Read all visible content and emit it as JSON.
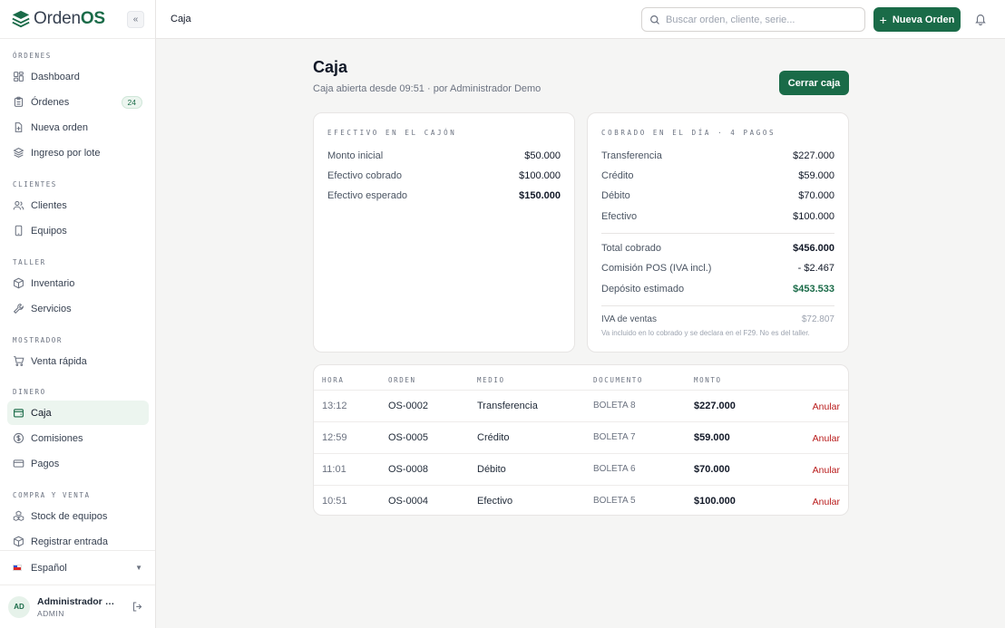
{
  "brand": {
    "name_a": "Orden",
    "name_b": "OS",
    "collapse": "«"
  },
  "sidebar": {
    "sections": [
      {
        "title": "ÓRDENES"
      },
      {
        "title": "CLIENTES"
      },
      {
        "title": "TALLER"
      },
      {
        "title": "MOSTRADOR"
      },
      {
        "title": "DINERO"
      },
      {
        "title": "COMPRA Y VENTA"
      }
    ],
    "items": [
      {
        "label": "Dashboard",
        "icon": "dashboard-icon"
      },
      {
        "label": "Órdenes",
        "icon": "clipboard-icon",
        "badge": "24"
      },
      {
        "label": "Nueva orden",
        "icon": "file-plus-icon"
      },
      {
        "label": "Ingreso por lote",
        "icon": "layers-icon"
      },
      {
        "label": "Clientes",
        "icon": "users-icon"
      },
      {
        "label": "Equipos",
        "icon": "phone-icon"
      },
      {
        "label": "Inventario",
        "icon": "box-icon"
      },
      {
        "label": "Servicios",
        "icon": "wrench-icon"
      },
      {
        "label": "Venta rápida",
        "icon": "cart-icon"
      },
      {
        "label": "Caja",
        "icon": "wallet-icon",
        "active": true
      },
      {
        "label": "Comisiones",
        "icon": "dollar-circle-icon"
      },
      {
        "label": "Pagos",
        "icon": "credit-card-icon"
      },
      {
        "label": "Stock de equipos",
        "icon": "boxes-icon"
      },
      {
        "label": "Registrar entrada",
        "icon": "box-icon"
      }
    ],
    "language": "Español",
    "user": {
      "initials": "AD",
      "name": "Administrador Demo",
      "role": "ADMIN"
    }
  },
  "topbar": {
    "breadcrumb": "Caja",
    "search_placeholder": "Buscar orden, cliente, serie...",
    "new_order": "Nueva Orden"
  },
  "page": {
    "title": "Caja",
    "subtitle": "Caja abierta desde 09:51 · por Administrador Demo",
    "close_button": "Cerrar caja"
  },
  "cash_card": {
    "title": "EFECTIVO EN EL CAJÓN",
    "rows": [
      {
        "label": "Monto inicial",
        "value": "$50.000"
      },
      {
        "label": "Efectivo cobrado",
        "value": "$100.000"
      },
      {
        "label": "Efectivo esperado",
        "value": "$150.000"
      }
    ]
  },
  "day_card": {
    "title": "COBRADO EN EL DÍA · 4 PAGOS",
    "methods": [
      {
        "label": "Transferencia",
        "value": "$227.000"
      },
      {
        "label": "Crédito",
        "value": "$59.000"
      },
      {
        "label": "Débito",
        "value": "$70.000"
      },
      {
        "label": "Efectivo",
        "value": "$100.000"
      }
    ],
    "totals": [
      {
        "label": "Total cobrado",
        "value": "$456.000"
      },
      {
        "label": "Comisión POS (IVA incl.)",
        "value": "- $2.467"
      },
      {
        "label": "Depósito estimado",
        "value": "$453.533"
      }
    ],
    "iva_label": "IVA de ventas",
    "iva_value": "$72.807",
    "iva_note": "Va incluido en lo cobrado y se declara en el F29. No es del taller."
  },
  "payments_table": {
    "headers": {
      "time": "HORA",
      "order": "ORDEN",
      "method": "MEDIO",
      "document": "DOCUMENTO",
      "amount": "MONTO"
    },
    "rows": [
      {
        "time": "13:12",
        "order": "OS-0002",
        "method": "Transferencia",
        "document": "BOLETA 8",
        "amount": "$227.000",
        "action": "Anular"
      },
      {
        "time": "12:59",
        "order": "OS-0005",
        "method": "Crédito",
        "document": "BOLETA 7",
        "amount": "$59.000",
        "action": "Anular"
      },
      {
        "time": "11:01",
        "order": "OS-0008",
        "method": "Débito",
        "document": "BOLETA 6",
        "amount": "$70.000",
        "action": "Anular"
      },
      {
        "time": "10:51",
        "order": "OS-0004",
        "method": "Efectivo",
        "document": "BOLETA 5",
        "amount": "$100.000",
        "action": "Anular"
      }
    ]
  },
  "colors": {
    "accent": "#1a6b48",
    "danger": "#b91c1c",
    "background": "#f5f5f4"
  }
}
